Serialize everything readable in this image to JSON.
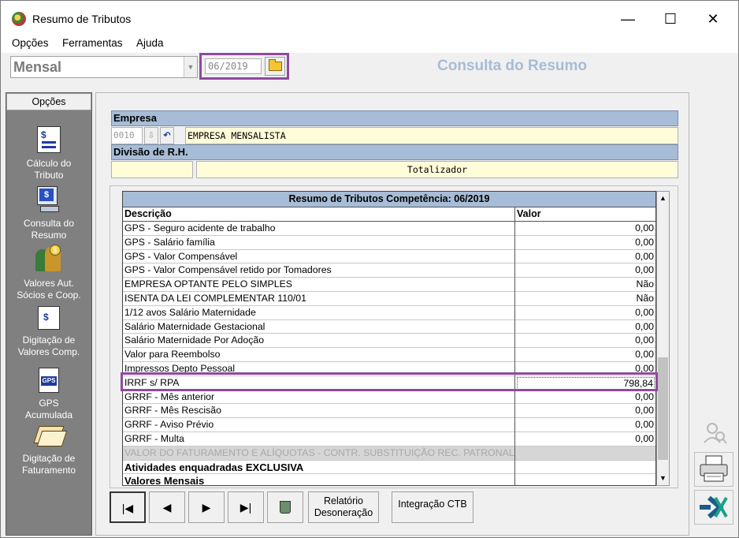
{
  "window": {
    "title": "Resumo de Tributos",
    "minimize": "—",
    "maximize": "☐",
    "close": "✕"
  },
  "menu": {
    "items": [
      "Opções",
      "Ferramentas",
      "Ajuda"
    ]
  },
  "toolbar": {
    "period_type": "Mensal",
    "competencia": "06/2019",
    "header_title": "Consulta do Resumo"
  },
  "left_panel": {
    "header": "Opções",
    "items": [
      "Cálculo do Tributo",
      "Consulta do Resumo",
      "Valores Aut. Sócios e  Coop.",
      "Digitação de Valores Comp.",
      "GPS Acumulada",
      "Digitação de Faturamento"
    ]
  },
  "empresa": {
    "label": "Empresa",
    "code": "0010",
    "name": "EMPRESA MENSALISTA"
  },
  "divisao": {
    "label": "Divisão de R.H.",
    "code": "",
    "name": "Totalizador"
  },
  "grid": {
    "title": "Resumo de Tributos Competência: 06/2019",
    "col_descricao": "Descrição",
    "col_valor": "Valor",
    "rows": [
      {
        "descricao": "GPS - Seguro acidente de trabalho",
        "valor": "0,00"
      },
      {
        "descricao": "GPS - Salário família",
        "valor": "0,00"
      },
      {
        "descricao": "GPS - Valor Compensável",
        "valor": "0,00"
      },
      {
        "descricao": "GPS - Valor Compensável retido por Tomadores",
        "valor": "0,00"
      },
      {
        "descricao": "EMPRESA OPTANTE PELO SIMPLES",
        "valor": "Não"
      },
      {
        "descricao": "ISENTA DA LEI COMPLEMENTAR 110/01",
        "valor": "Não"
      },
      {
        "descricao": "1/12 avos Salário Maternidade",
        "valor": "0,00"
      },
      {
        "descricao": "Salário Maternidade Gestacional",
        "valor": "0,00"
      },
      {
        "descricao": "Salário Maternidade Por Adoção",
        "valor": "0,00"
      },
      {
        "descricao": "Valor para Reembolso",
        "valor": "0,00"
      },
      {
        "descricao": "Impressos Depto Pessoal",
        "valor": "0,00"
      },
      {
        "descricao": "IRRF s/ RPA",
        "valor": "798,84"
      },
      {
        "descricao": "GRRF - Mês anterior",
        "valor": "0,00"
      },
      {
        "descricao": "GRRF - Mês Rescisão",
        "valor": "0,00"
      },
      {
        "descricao": "GRRF - Aviso Prévio",
        "valor": "0,00"
      },
      {
        "descricao": "GRRF - Multa",
        "valor": "0,00"
      },
      {
        "descricao": "VALOR DO FATURAMENTO E ALÍQUOTAS - CONTR. SUBSTITUIÇÃO REC. PATRONAL",
        "valor": ""
      },
      {
        "descricao": "Atividades enquadradas EXCLUSIVA",
        "valor": ""
      },
      {
        "descricao": "Valores Mensais",
        "valor": ""
      }
    ]
  },
  "bottom": {
    "first": "|◀",
    "prev": "◀",
    "next": "▶",
    "last": "▶|",
    "relatorio": "Relatório Desoneração",
    "integracao": "Integração CTB"
  },
  "colors": {
    "accent_blue": "#a7bcd6",
    "highlight_purple": "#8e4a9e",
    "field_yellow": "#fffcd9"
  }
}
